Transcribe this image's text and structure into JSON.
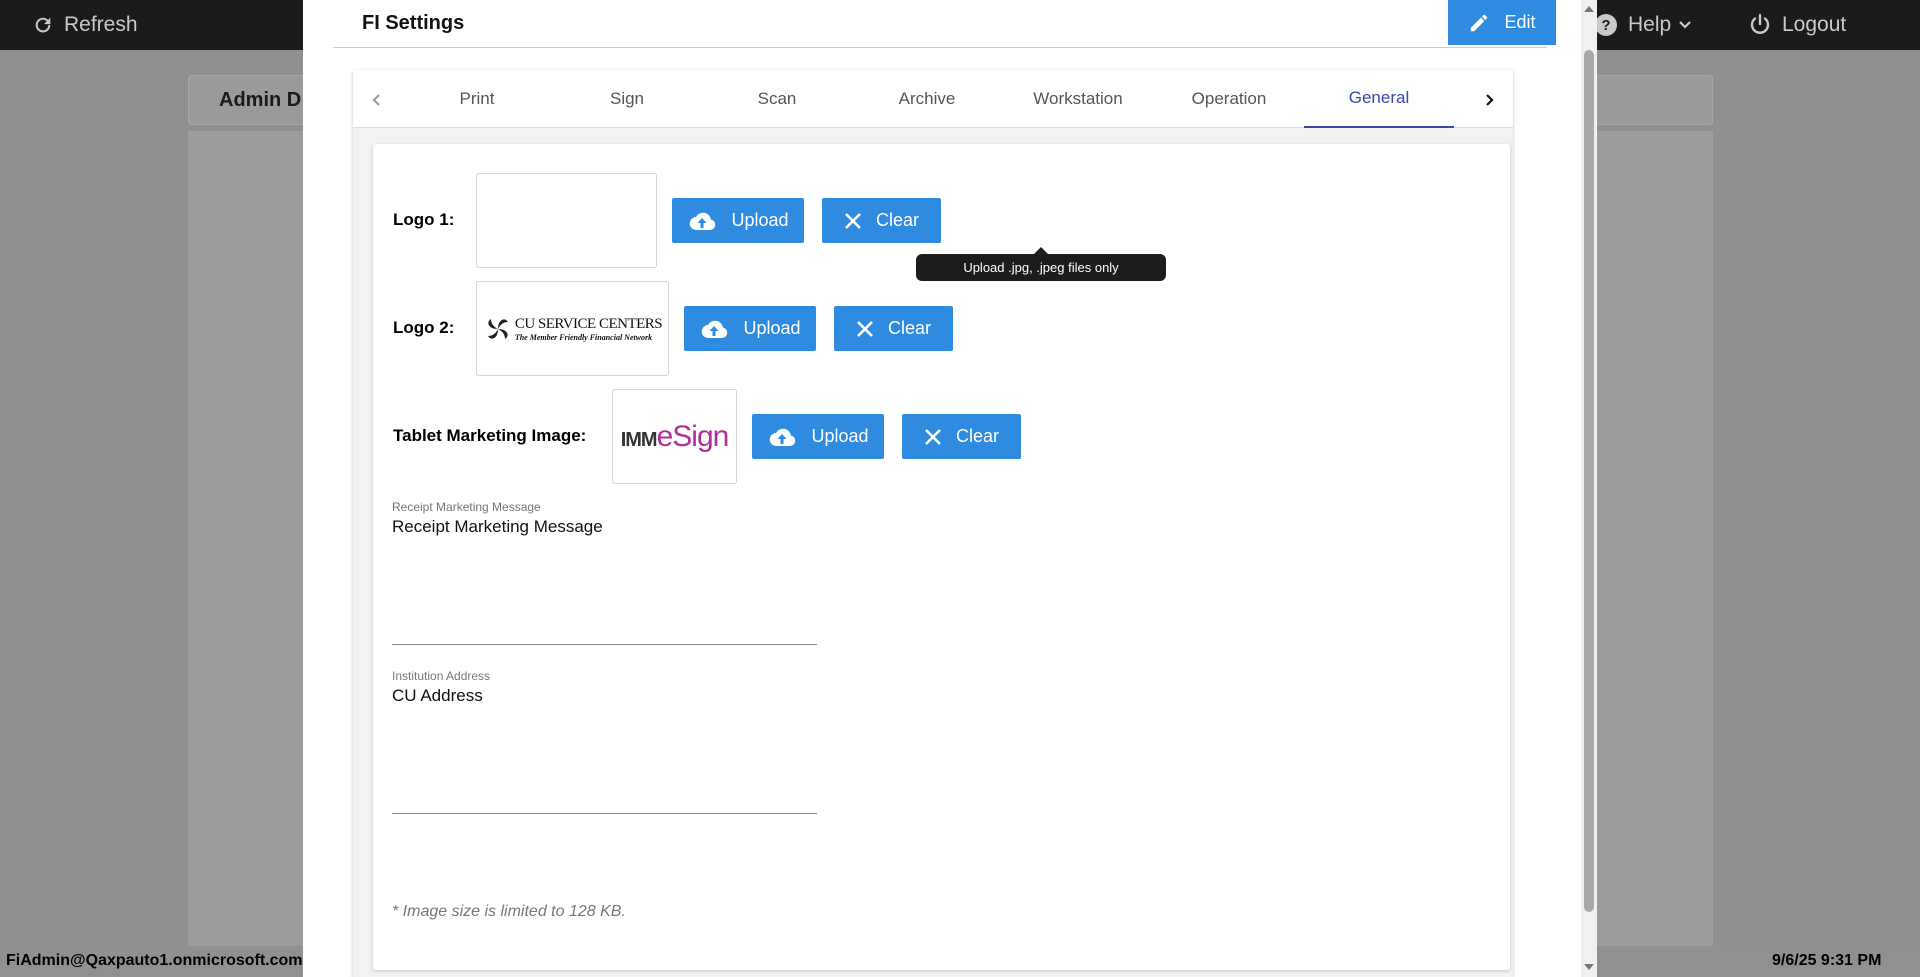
{
  "topbar": {
    "refresh_label": "Refresh",
    "help_label": "Help",
    "logout_label": "Logout"
  },
  "background": {
    "panel_title": "Admin D"
  },
  "statusbar": {
    "user": "FiAdmin@Qaxpauto1.onmicrosoft.com",
    "datetime": "9/6/25 9:31 PM"
  },
  "modal": {
    "title": "FI Settings",
    "edit_label": "Edit",
    "tabs": [
      {
        "label": "Print"
      },
      {
        "label": "Sign"
      },
      {
        "label": "Scan"
      },
      {
        "label": "Archive"
      },
      {
        "label": "Workstation"
      },
      {
        "label": "Operation"
      },
      {
        "label": "General"
      }
    ],
    "active_tab": "General"
  },
  "general": {
    "logo1": {
      "label": "Logo 1:",
      "upload_label": "Upload",
      "clear_label": "Clear"
    },
    "logo2": {
      "label": "Logo 2:",
      "upload_label": "Upload",
      "clear_label": "Clear",
      "logo_name": "CU SERVICE CENTERS",
      "logo_tagline": "The Member Friendly Financial Network"
    },
    "tablet": {
      "label": "Tablet Marketing Image:",
      "upload_label": "Upload",
      "clear_label": "Clear",
      "logo_part1": "IMM",
      "logo_part2": "eSign"
    },
    "tooltip": "Upload .jpg, .jpeg files only",
    "receipt": {
      "label": "Receipt Marketing Message",
      "value": "Receipt Marketing Message"
    },
    "address": {
      "label": "Institution Address",
      "value": "CU Address"
    },
    "note": "* Image size is limited to 128 KB."
  },
  "colors": {
    "primary": "#2f8be0",
    "tab_active": "#3949ab",
    "topbar": "#1b1b1b"
  }
}
